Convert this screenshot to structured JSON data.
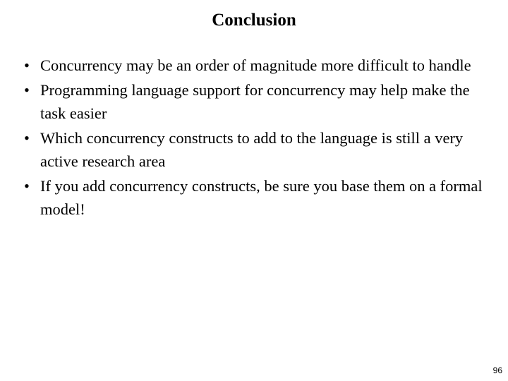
{
  "slide": {
    "title": "Conclusion",
    "page_number": "96",
    "bullet_marker": "•",
    "background_color": "#ffffff",
    "text_color": "#000000",
    "bullets": [
      {
        "text": "Concurrency may be an order of magnitude more difficult to handle"
      },
      {
        "text": "Programming language support for concurrency may help make the task easier"
      },
      {
        "text": "Which concurrency constructs to add to the language is still a very active research area"
      },
      {
        "text": "If you add concurrency constructs, be sure you base them on a formal model!"
      }
    ]
  }
}
